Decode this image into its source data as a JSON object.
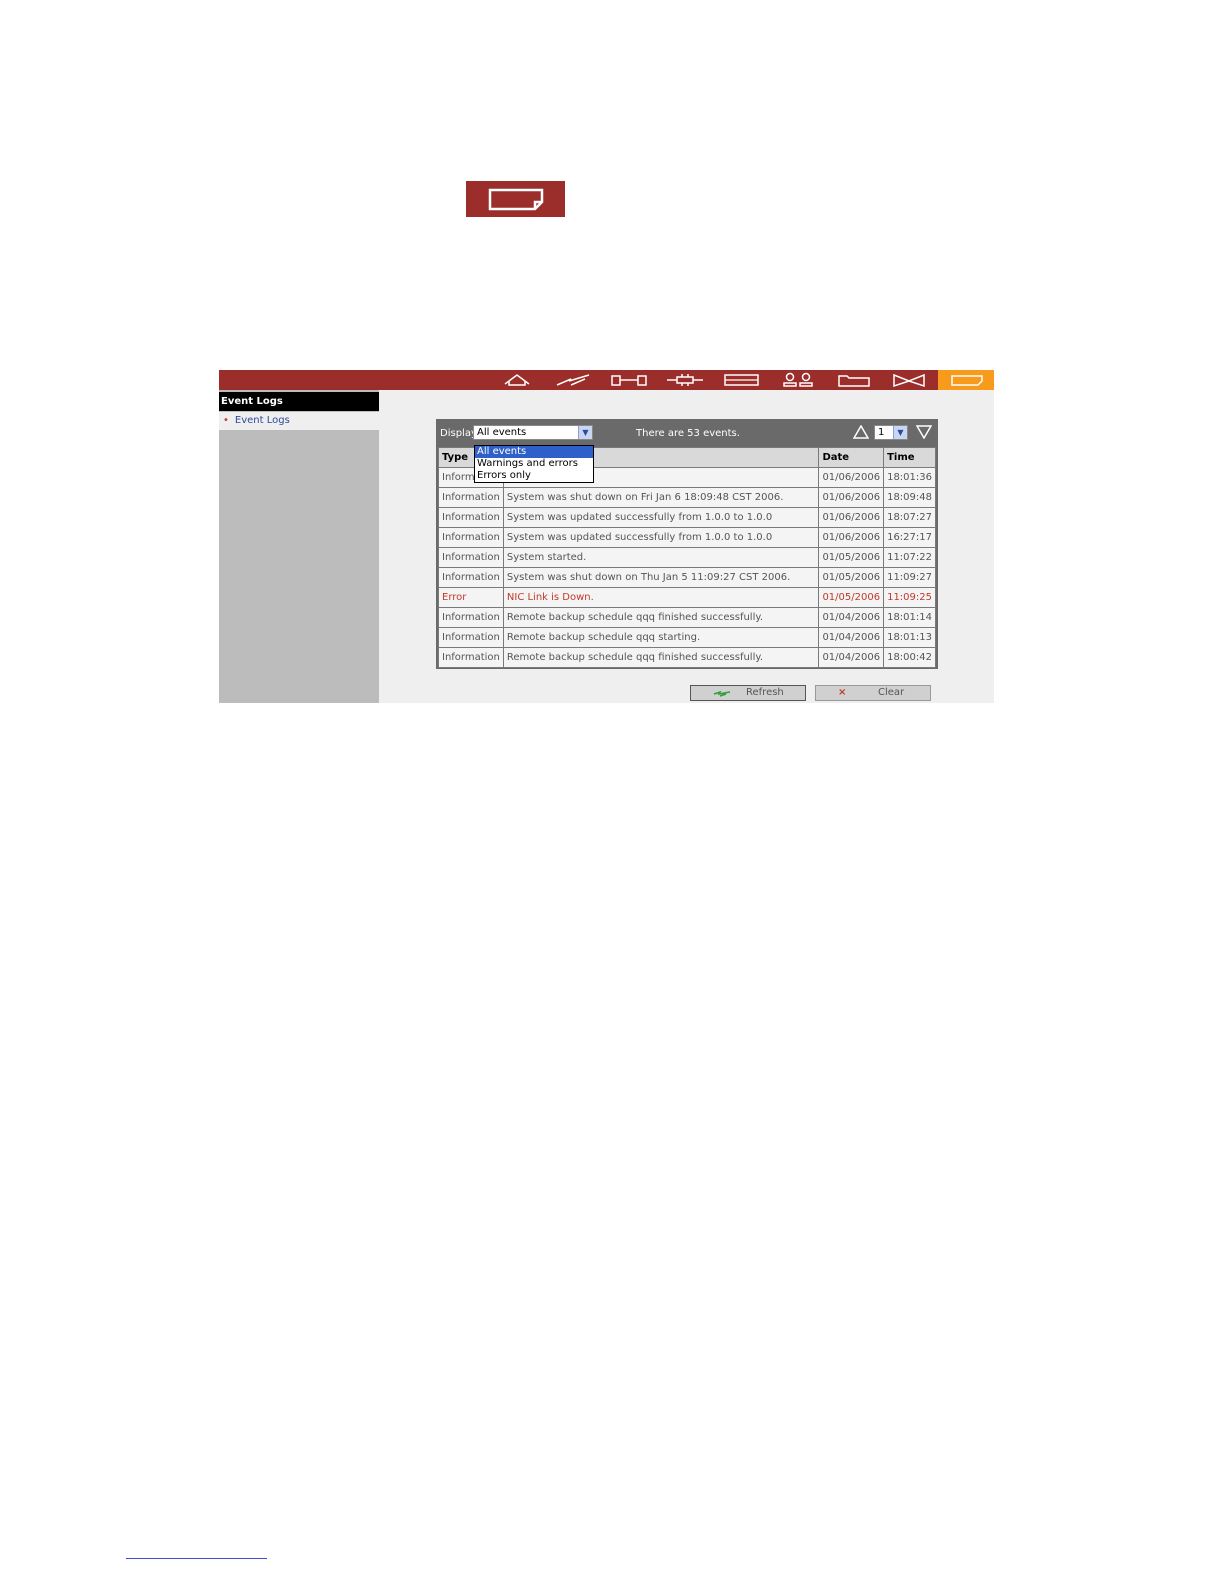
{
  "topbar": {
    "colors": {
      "bar": "#9b2d2a",
      "active": "#f89b1c"
    },
    "icons": [
      "home-icon",
      "flash-icon",
      "network-icon",
      "plug-icon",
      "disk-icon",
      "users-icon",
      "folder-icon",
      "bowtie-icon",
      "logs-icon"
    ],
    "active_icon": "logs-icon"
  },
  "sidebar": {
    "title": "Event Logs",
    "items": [
      {
        "label": "Event Logs"
      }
    ]
  },
  "panel": {
    "display_label": "Display",
    "display_value": "All events",
    "events_count": "There are 53 events.",
    "page_value": "1",
    "dropdown_options": [
      {
        "label": "All events",
        "selected": true
      },
      {
        "label": "Warnings and errors",
        "selected": false
      },
      {
        "label": "Errors only",
        "selected": false
      }
    ],
    "columns": [
      "Type",
      "",
      "Date",
      "Time"
    ],
    "rows": [
      {
        "type": "Informa",
        "message": "",
        "date": "01/06/2006",
        "time": "18:01:36",
        "error": false
      },
      {
        "type": "Information",
        "message": "System was shut down on Fri Jan 6 18:09:48 CST 2006.",
        "date": "01/06/2006",
        "time": "18:09:48",
        "error": false
      },
      {
        "type": "Information",
        "message": "System was updated successfully from 1.0.0 to 1.0.0",
        "date": "01/06/2006",
        "time": "18:07:27",
        "error": false
      },
      {
        "type": "Information",
        "message": "System was updated successfully from 1.0.0 to 1.0.0",
        "date": "01/06/2006",
        "time": "16:27:17",
        "error": false
      },
      {
        "type": "Information",
        "message": "System started.",
        "date": "01/05/2006",
        "time": "11:07:22",
        "error": false
      },
      {
        "type": "Information",
        "message": "System was shut down on Thu Jan 5 11:09:27 CST 2006.",
        "date": "01/05/2006",
        "time": "11:09:27",
        "error": false
      },
      {
        "type": "Error",
        "message": "NIC Link is Down.",
        "date": "01/05/2006",
        "time": "11:09:25",
        "error": true
      },
      {
        "type": "Information",
        "message": "Remote backup schedule qqq finished successfully.",
        "date": "01/04/2006",
        "time": "18:01:14",
        "error": false
      },
      {
        "type": "Information",
        "message": "Remote backup schedule qqq starting.",
        "date": "01/04/2006",
        "time": "18:01:13",
        "error": false
      },
      {
        "type": "Information",
        "message": "Remote backup schedule qqq finished successfully.",
        "date": "01/04/2006",
        "time": "18:00:42",
        "error": false
      }
    ]
  },
  "buttons": {
    "refresh": "Refresh",
    "clear": "Clear"
  }
}
